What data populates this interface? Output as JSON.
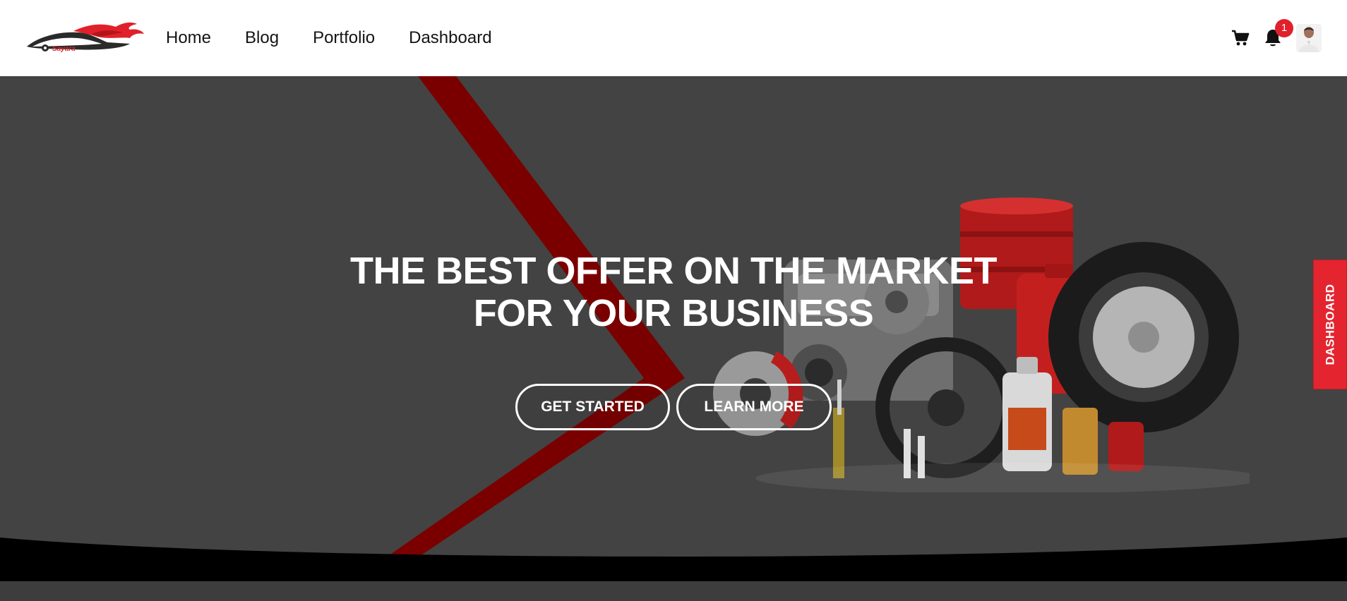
{
  "brand": {
    "logo_text": "Sayara",
    "accent": "#e0202a"
  },
  "nav": {
    "items": [
      {
        "label": "Home"
      },
      {
        "label": "Blog"
      },
      {
        "label": "Portfolio"
      },
      {
        "label": "Dashboard"
      }
    ]
  },
  "header_icons": {
    "cart_icon": "shopping-cart-icon",
    "bell_icon": "notification-bell-icon",
    "notification_count": "1",
    "avatar": "user-avatar"
  },
  "hero": {
    "headline_line1": "THE BEST OFFER ON THE MARKET",
    "headline_line2": "FOR YOUR BUSINESS",
    "get_started_label": "GET STARTED",
    "learn_more_label": "LEARN MORE",
    "background_color": "#434343",
    "stripe_color": "#7a0000"
  },
  "side_tab": {
    "label": "DASHBOARD",
    "color": "#e4252f"
  }
}
